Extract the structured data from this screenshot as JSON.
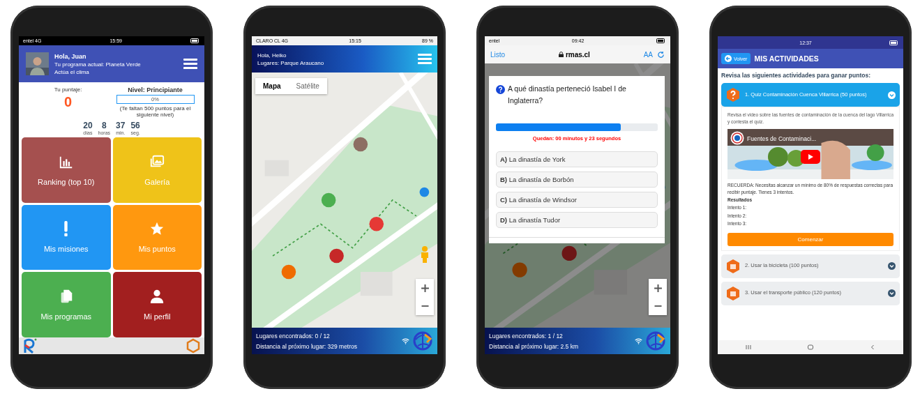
{
  "phones": [
    {
      "kind": "home",
      "status": {
        "carrier": "entel 4G",
        "time": "15:59"
      },
      "header": {
        "greeting": "Hola, Juan",
        "program": "Tu programa actual: Planeta Verde",
        "subtitle": "Actúa el clima"
      },
      "score": {
        "label": "Tu puntaje:",
        "value": "0"
      },
      "level": {
        "title": "Nivel: Principiante",
        "progress": {
          "level": 0,
          "label": "0%"
        },
        "note": "(Te faltan 500 puntos para el siguiente nivel)"
      },
      "countdown": [
        {
          "value": "20",
          "unit": "días"
        },
        {
          "value": "8",
          "unit": "horas"
        },
        {
          "value": "37",
          "unit": "min."
        },
        {
          "value": "56",
          "unit": "seg."
        }
      ],
      "tiles": [
        {
          "label": "Ranking (top 10)",
          "kind": "chart",
          "color": "#a5504f"
        },
        {
          "label": "Galería",
          "kind": "gallery",
          "color": "#efc319"
        },
        {
          "label": "Mis misiones",
          "kind": "alert",
          "color": "#2196f3"
        },
        {
          "label": "Mis puntos",
          "kind": "star",
          "color": "#ff980f"
        },
        {
          "label": "Mis programas",
          "kind": "files",
          "color": "#4caf50"
        },
        {
          "label": "Mi perfil",
          "kind": "person",
          "color": "#a21f1f"
        }
      ]
    },
    {
      "kind": "map",
      "status": {
        "carrier": "CLARO CL 4G",
        "time": "15:15",
        "battery": "89 %"
      },
      "header": {
        "greeting": "Hola, Heiko",
        "place": "Lugares: Parque Araucano"
      },
      "map_types": [
        {
          "label": "Mapa",
          "selected": true
        },
        {
          "label": "Satélite",
          "selected": false
        }
      ],
      "footer": {
        "found": "Lugares encontrados: 0 / 12",
        "distance": "Distancia al próximo lugar: 329 metros"
      }
    },
    {
      "kind": "quiz",
      "status": {
        "carrier": "entel",
        "time": "09:42"
      },
      "browser": {
        "done": "Listo",
        "url": "rmas.cl",
        "text_size": "AA"
      },
      "question": "A qué dinastía perteneció Isabel I de Inglaterra?",
      "timer": {
        "level": 0.77,
        "text": "Quedan: 00 minutos y 23 segundos"
      },
      "options": [
        "**A)** La dinastía de York",
        "**B)** La dinastía de Borbón",
        "**C)** La dinastía de Windsor",
        "**D)** La dinastía Tudor"
      ],
      "footer": {
        "found": "Lugares encontrados: 1 / 12",
        "distance": "Distancia al próximo lugar: 2.5 km"
      }
    },
    {
      "kind": "activities",
      "status": {
        "time": "12:37"
      },
      "header": {
        "back": "Volver",
        "title": "MIS ACTIVIDADES"
      },
      "intro": "Revisa las siguientes actividades para ganar puntos:",
      "activities": [
        {
          "title": "1. Quiz Contaminación Cuenca Villarrica (50 puntos)",
          "expanded": true,
          "description": "Revisa el video sobre las fuentes de contaminación de la cuenca del lago Villarrica y contesta el quiz.",
          "video_title": "Fuentes de Contaminaci...",
          "reminder": "RECUERDA: Necesitas alcanzar un mínimo de 80% de respuestas correctas para recibir puntaje. Tienes 3 intentos.",
          "results_title": "Resultados",
          "attempts": [
            "Intento 1:",
            "Intento 2:",
            "Intento 3:"
          ],
          "action": "Comenzar"
        },
        {
          "title": "2. Usar la bicicleta (100 puntos)",
          "expanded": false
        },
        {
          "title": "3. Usar el transporte público (120 puntos)",
          "expanded": false
        }
      ]
    }
  ]
}
